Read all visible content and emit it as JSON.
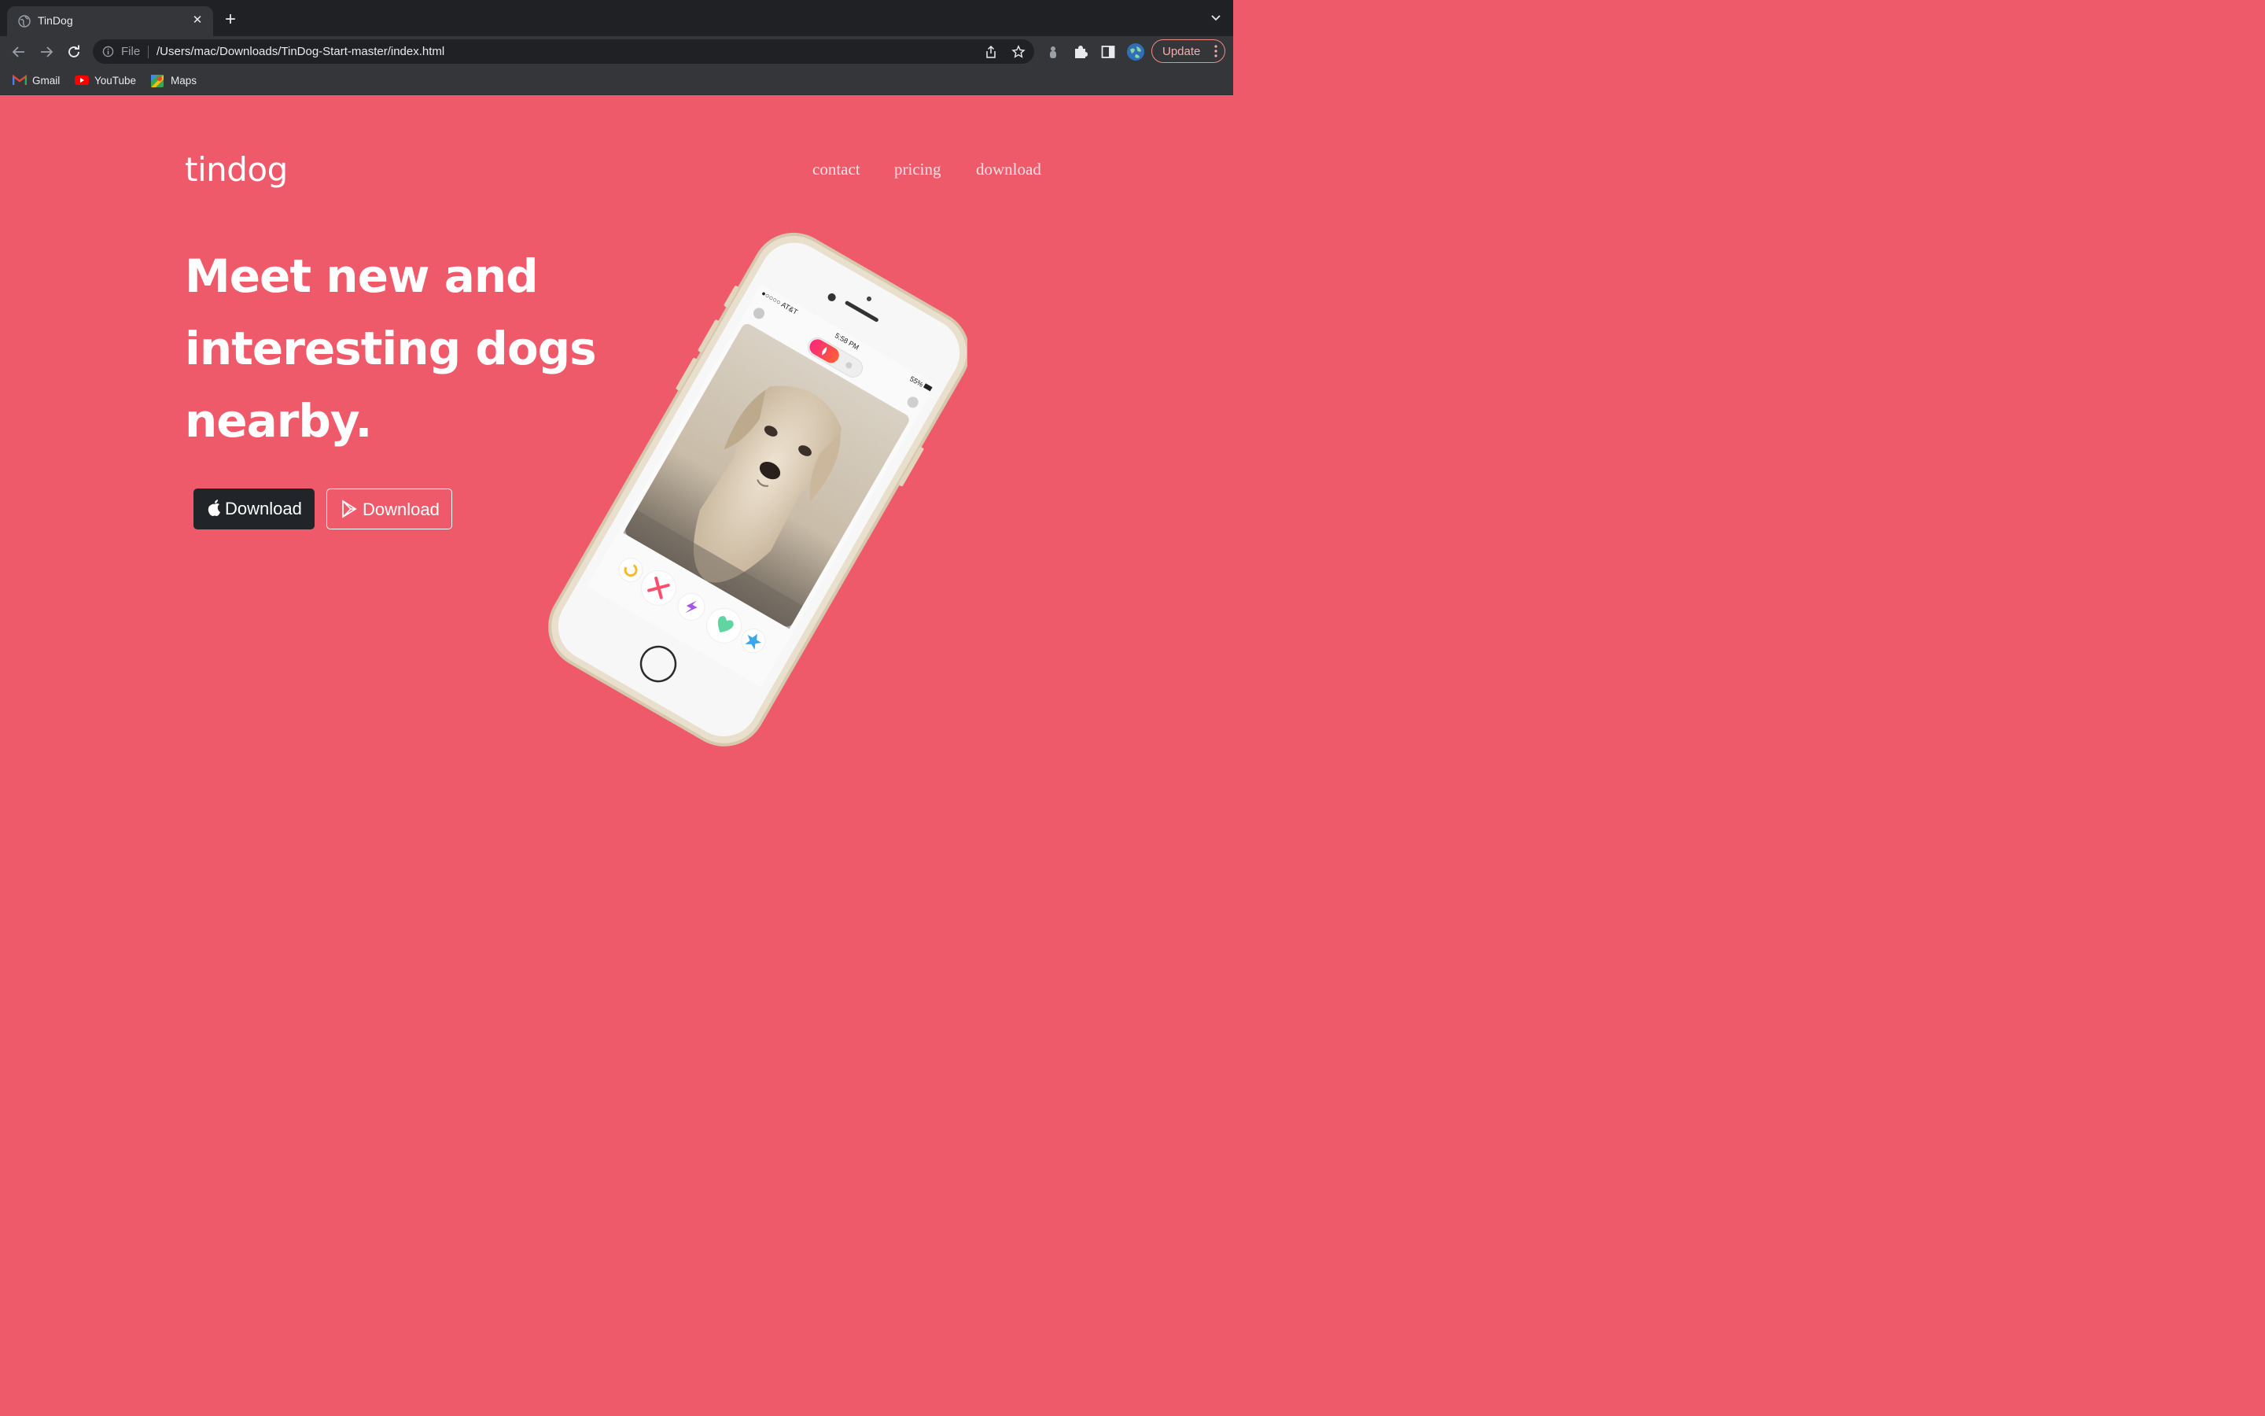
{
  "browser": {
    "tab": {
      "title": "TinDog"
    },
    "address": {
      "scheme": "File",
      "url": "/Users/mac/Downloads/TinDog-Start-master/index.html"
    },
    "update_label": "Update",
    "bookmarks": [
      {
        "label": "Gmail",
        "icon": "gmail-icon"
      },
      {
        "label": "YouTube",
        "icon": "youtube-icon"
      },
      {
        "label": "Maps",
        "icon": "maps-icon"
      }
    ]
  },
  "page": {
    "brand": "tindog",
    "nav": [
      {
        "label": "contact"
      },
      {
        "label": "pricing"
      },
      {
        "label": "download"
      }
    ],
    "headline": "Meet new and interesting dogs nearby.",
    "buttons": [
      {
        "label": "Download",
        "icon": "apple-icon"
      },
      {
        "label": "Download",
        "icon": "google-play-icon"
      }
    ],
    "phone": {
      "carrier": "●○○○○ AT&T",
      "time": "5:58 PM",
      "battery": "55%"
    }
  },
  "colors": {
    "brand_bg": "#ef5a6b",
    "dark_button": "#212529",
    "chrome_dark": "#202124",
    "chrome_toolbar": "#35363a"
  }
}
